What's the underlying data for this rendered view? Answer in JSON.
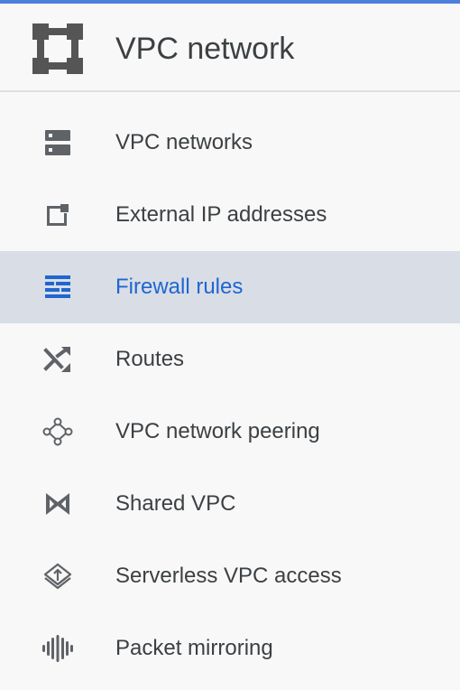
{
  "header": {
    "title": "VPC network",
    "icon": "vpc-network-icon"
  },
  "colors": {
    "accent": "#4d7fdb",
    "active_background": "#d9dde5",
    "active_text": "#1f66d1",
    "text": "#3c4043",
    "icon": "#5f6368"
  },
  "menu": {
    "items": [
      {
        "label": "VPC networks",
        "icon": "vpc-networks-icon",
        "active": false
      },
      {
        "label": "External IP addresses",
        "icon": "external-ip-icon",
        "active": false
      },
      {
        "label": "Firewall rules",
        "icon": "firewall-icon",
        "active": true
      },
      {
        "label": "Routes",
        "icon": "routes-icon",
        "active": false
      },
      {
        "label": "VPC network peering",
        "icon": "peering-icon",
        "active": false
      },
      {
        "label": "Shared VPC",
        "icon": "shared-vpc-icon",
        "active": false
      },
      {
        "label": "Serverless VPC access",
        "icon": "serverless-icon",
        "active": false
      },
      {
        "label": "Packet mirroring",
        "icon": "packet-mirroring-icon",
        "active": false
      }
    ]
  }
}
